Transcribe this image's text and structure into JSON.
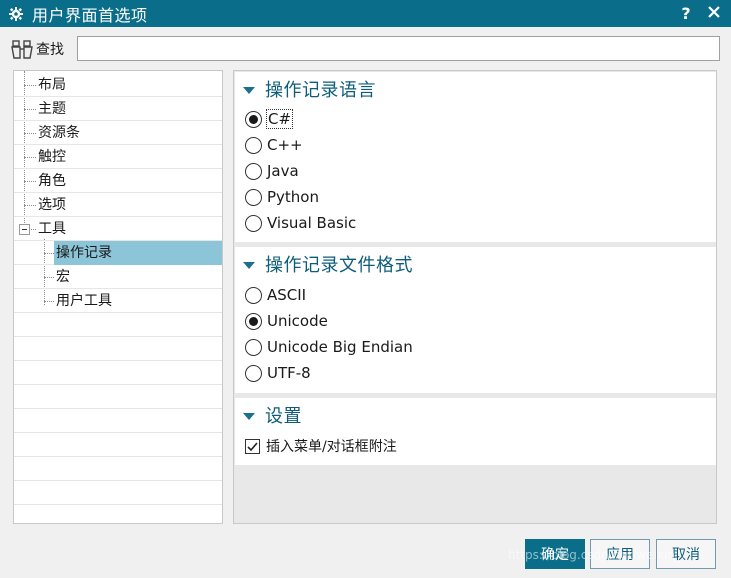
{
  "window": {
    "title": "用户界面首选项",
    "help_label": "?",
    "icon": "gear-icon"
  },
  "find": {
    "label": "查找",
    "value": "",
    "placeholder": ""
  },
  "tree": {
    "items": [
      {
        "label": "布局"
      },
      {
        "label": "主题"
      },
      {
        "label": "资源条"
      },
      {
        "label": "触控"
      },
      {
        "label": "角色"
      },
      {
        "label": "选项"
      },
      {
        "label": "工具",
        "expanded": true
      },
      {
        "label": "操作记录",
        "selected": true
      },
      {
        "label": "宏"
      },
      {
        "label": "用户工具"
      }
    ]
  },
  "sections": {
    "language": {
      "title": "操作记录语言",
      "options": [
        "C#",
        "C++",
        "Java",
        "Python",
        "Visual Basic"
      ],
      "selected": "C#"
    },
    "format": {
      "title": "操作记录文件格式",
      "options": [
        "ASCII",
        "Unicode",
        "Unicode Big Endian",
        "UTF-8"
      ],
      "selected": "Unicode"
    },
    "settings": {
      "title": "设置",
      "checkbox_label": "插入菜单/对话框附注",
      "checked": true
    }
  },
  "buttons": {
    "ok": "确定",
    "apply": "应用",
    "cancel": "取消"
  },
  "watermark": "https://blog.csdn.net/weixin_..."
}
